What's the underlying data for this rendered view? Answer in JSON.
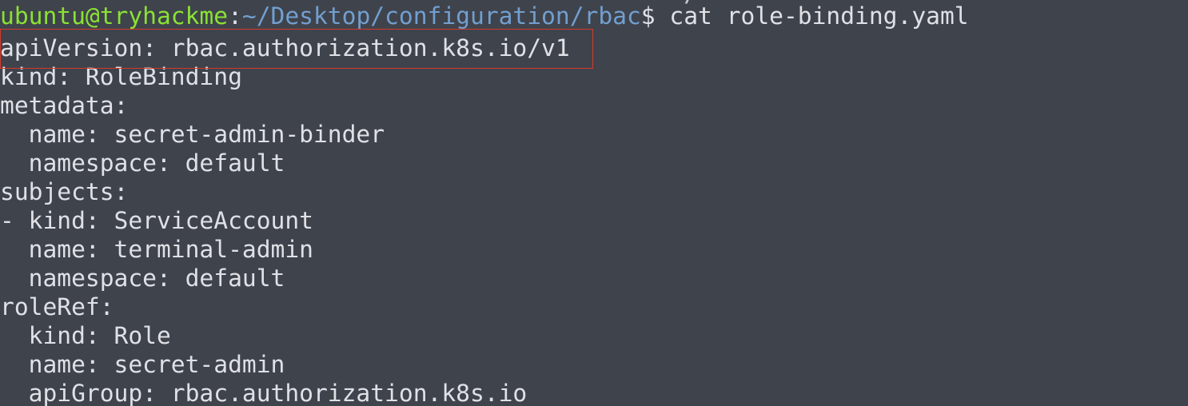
{
  "prompt": {
    "previous_line_fragment": "· · · · · · · · · · · · · · · · · · · · · · · · /",
    "user_host": "ubuntu@tryhackme",
    "colon": ":",
    "path": "~/Desktop/configuration/rbac",
    "symbol": "$",
    "command": " cat role-binding.yaml"
  },
  "output_lines": [
    "apiVersion: rbac.authorization.k8s.io/v1",
    "kind: RoleBinding",
    "metadata:",
    "  name: secret-admin-binder",
    "  namespace: default",
    "subjects:",
    "- kind: ServiceAccount",
    "  name: terminal-admin",
    "  namespace: default",
    "roleRef:",
    "  kind: Role",
    "  name: secret-admin",
    "  apiGroup: rbac.authorization.k8s.io"
  ],
  "colors": {
    "background": "#3f434c",
    "text": "#dfe1e6",
    "user_host": "#8ae234",
    "path": "#729fcf",
    "highlight_border": "#d33a2c"
  }
}
